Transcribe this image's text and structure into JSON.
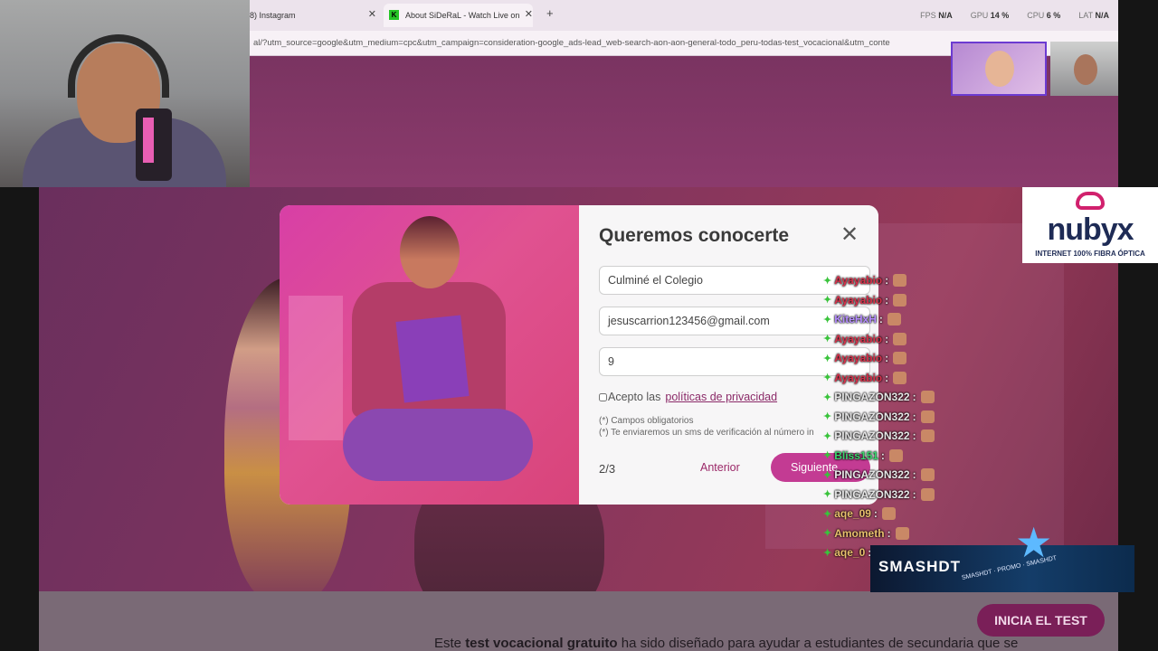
{
  "browser": {
    "tabs": [
      {
        "label": "8) Instagram"
      },
      {
        "label": "About SiDeRaL - Watch Live on"
      }
    ],
    "new_tab_glyph": "+",
    "close_glyph": "✕",
    "url": "al/?utm_source=google&utm_medium=cpc&utm_campaign=consideration-google_ads-lead_web-search-aon-aon-general-todo_peru-todas-test_vocacional&utm_conte"
  },
  "stats": [
    {
      "label": "FPS",
      "value": "N/A"
    },
    {
      "label": "GPU",
      "value": "14 %"
    },
    {
      "label": "CPU",
      "value": "6 %"
    },
    {
      "label": "LAT",
      "value": "N/A"
    }
  ],
  "modal": {
    "title": "Queremos conocerte",
    "close_glyph": "✕",
    "field_school": "Culminé el Colegio",
    "field_email": "jesuscarrion123456@gmail.com",
    "field_phone": "9",
    "consent_prefix": "Acepto las",
    "consent_link": "políticas de privacidad",
    "note_required": "(*) Campos obligatorios",
    "note_sms": "(*) Te enviaremos un sms de verificación al número in",
    "step": "2/3",
    "prev_label": "Anterior",
    "next_label": "Siguiente"
  },
  "page": {
    "desc_prefix": "Este",
    "desc_bold": "test vocacional gratuito",
    "desc_suffix": "ha sido diseñado para ayudar a estudiantes de secundaria que se",
    "cta": "INICIA EL TEST"
  },
  "sponsor": {
    "name": "nubyx",
    "tagline": "INTERNET 100% FIBRA ÓPTICA"
  },
  "chat": [
    {
      "user": "Ayayabio",
      "color": "red"
    },
    {
      "user": "Ayayabio",
      "color": "red"
    },
    {
      "user": "KiteHxH",
      "color": "purple"
    },
    {
      "user": "Ayayabio",
      "color": "red"
    },
    {
      "user": "Ayayabio",
      "color": "red"
    },
    {
      "user": "Ayayabio",
      "color": "red"
    },
    {
      "user": "PINGAZON322",
      "color": "white"
    },
    {
      "user": "PINGAZON322",
      "color": "white"
    },
    {
      "user": "PINGAZON322",
      "color": "white"
    },
    {
      "user": "Bliss151",
      "color": "green"
    },
    {
      "user": "PINGAZON322",
      "color": "white"
    },
    {
      "user": "PINGAZON322",
      "color": "white"
    },
    {
      "user": "aqe_09",
      "color": "gold"
    },
    {
      "user": "Amometh",
      "color": "gold"
    },
    {
      "user": "aqe_0",
      "color": "gold"
    }
  ],
  "overlay": {
    "brand": "SMASHDT",
    "promo": "SMASHDT · PROMO · SMASHDT"
  }
}
